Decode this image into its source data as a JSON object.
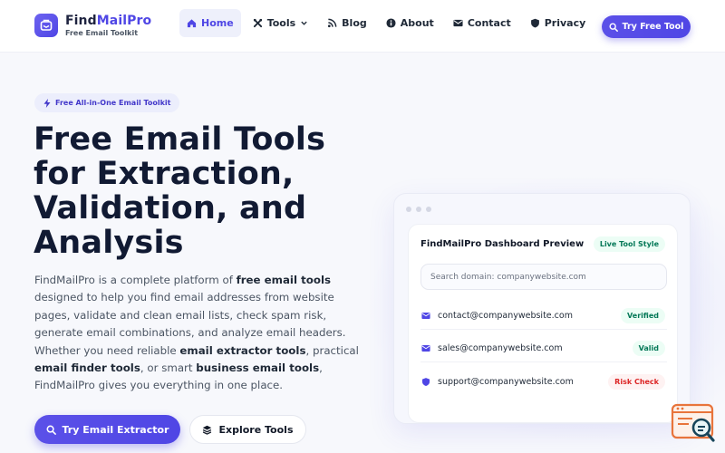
{
  "brand": {
    "name_part1": "Find",
    "name_part2": "MailPro",
    "tagline": "Free Email Toolkit"
  },
  "nav": {
    "items": [
      {
        "label": "Home",
        "icon": "home-icon",
        "active": true
      },
      {
        "label": "Tools",
        "icon": "tools-icon",
        "dropdown": true
      },
      {
        "label": "Blog",
        "icon": "rss-icon"
      },
      {
        "label": "About",
        "icon": "info-icon"
      },
      {
        "label": "Contact",
        "icon": "envelope-icon"
      },
      {
        "label": "Privacy",
        "icon": "shield-icon"
      }
    ],
    "cta_label": "Try Free Tool"
  },
  "hero": {
    "badge": "Free All-in-One Email Toolkit",
    "headline": "Free Email Tools for Extraction, Validation, and Analysis",
    "desc": {
      "t1": "FindMailPro is a complete platform of ",
      "b1": "free email tools",
      "t2": " designed to help you find email addresses from website pages, validate and clean email lists, check spam risk, generate email combinations, and analyze email headers. Whether you need reliable ",
      "b2": "email extractor tools",
      "t3": ", practical ",
      "b3": "email finder tools",
      "t4": ", or smart ",
      "b4": "business email tools",
      "t5": ", FindMailPro gives you everything in one place."
    },
    "primary_button": "Try Email Extractor",
    "secondary_button": "Explore Tools"
  },
  "preview": {
    "title": "FindMailPro Dashboard Preview",
    "chip": "Live Tool Style",
    "search_placeholder": "Search domain: companywebsite.com",
    "rows": [
      {
        "email": "contact@companywebsite.com",
        "status": "Verified",
        "icon": "envelope-icon",
        "tone": "green"
      },
      {
        "email": "sales@companywebsite.com",
        "status": "Valid",
        "icon": "envelope-icon",
        "tone": "green"
      },
      {
        "email": "support@companywebsite.com",
        "status": "Risk Check",
        "icon": "shield-icon",
        "tone": "red"
      }
    ]
  },
  "colors": {
    "accent": "#4f46e5",
    "heading": "#111a33",
    "success": "#047857",
    "danger": "#dc2626",
    "widget": "#e8743b"
  }
}
